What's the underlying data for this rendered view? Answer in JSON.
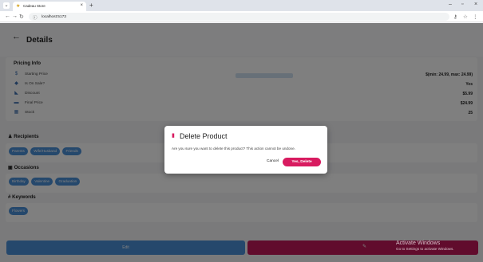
{
  "browser": {
    "tab_title": "Cadeau Store",
    "tab_list_icon": "chevron-down-icon",
    "new_tab_symbol": "+",
    "url": "localhost:5173",
    "window_controls": [
      "–",
      "▫",
      "×"
    ]
  },
  "header": {
    "back_symbol": "←",
    "title": "Details"
  },
  "pricing": {
    "title": "Pricing Info",
    "rows": [
      {
        "icon": "dollar-icon",
        "label": "Starting Price",
        "value": "$(min: 24.99, max: 24.99)"
      },
      {
        "icon": "tag-icon",
        "label": "Is On Sale?",
        "value": "Yes"
      },
      {
        "icon": "discount-icon",
        "label": "Discount",
        "value": "$5.99"
      },
      {
        "icon": "money-icon",
        "label": "Final Price",
        "value": "$24.99"
      },
      {
        "icon": "stock-icon",
        "label": "Stock",
        "value": "25"
      }
    ]
  },
  "recipients": {
    "title": "Recipients",
    "chips": [
      "Parents",
      "Wife/Husband",
      "Friends"
    ]
  },
  "occasions": {
    "title": "Occasions",
    "chips": [
      "Birthday",
      "Valentine",
      "Graduation"
    ]
  },
  "keywords": {
    "title": "Keywords",
    "chips": [
      "Flowers"
    ]
  },
  "actions": {
    "edit_label": "Edit"
  },
  "dialog": {
    "title": "Delete Product",
    "message": "Are you sure you want to delete this product? This action cannot be undone.",
    "cancel_label": "Cancel",
    "confirm_label": "Yes, Delete"
  },
  "watermark": {
    "title": "Activate Windows",
    "subtitle": "Go to Settings to activate Windows."
  },
  "colors": {
    "primary": "#4a90d9",
    "danger": "#d81b60"
  }
}
